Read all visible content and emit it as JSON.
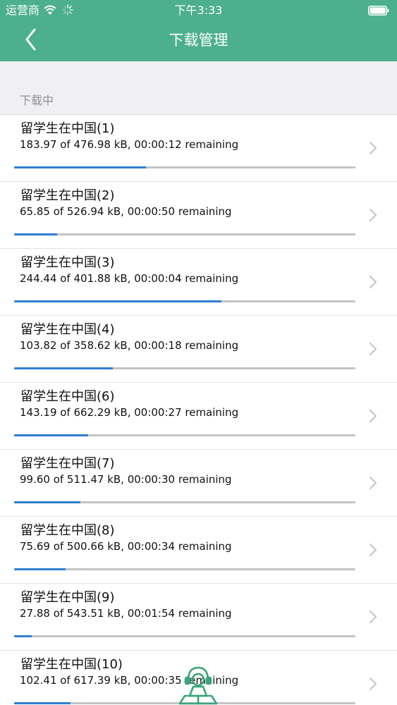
{
  "status_bar": {
    "carrier": "运营商",
    "time": "下午3:33"
  },
  "nav": {
    "title": "下载管理",
    "back_icon": "chevron-left-icon"
  },
  "section": {
    "header": "下载中"
  },
  "downloads": [
    {
      "title": "留学生在中国(1)",
      "detail": "183.97 of 476.98 kB, 00:00:12 remaining",
      "progress": 0.3857
    },
    {
      "title": "留学生在中国(2)",
      "detail": "65.85 of 526.94 kB, 00:00:50 remaining",
      "progress": 0.125
    },
    {
      "title": "留学生在中国(3)",
      "detail": "244.44 of 401.88 kB, 00:00:04 remaining",
      "progress": 0.6082
    },
    {
      "title": "留学生在中国(4)",
      "detail": "103.82 of 358.62 kB, 00:00:18 remaining",
      "progress": 0.2895
    },
    {
      "title": "留学生在中国(6)",
      "detail": "143.19 of 662.29 kB, 00:00:27 remaining",
      "progress": 0.2162
    },
    {
      "title": "留学生在中国(7)",
      "detail": "99.60 of 511.47 kB, 00:00:30 remaining",
      "progress": 0.1947
    },
    {
      "title": "留学生在中国(8)",
      "detail": "75.69 of 500.66 kB, 00:00:34 remaining",
      "progress": 0.1512
    },
    {
      "title": "留学生在中国(9)",
      "detail": "27.88 of 543.51 kB, 00:01:54 remaining",
      "progress": 0.0513
    },
    {
      "title": "留学生在中国(10)",
      "detail": "102.41 of 617.39 kB, 00:00:35 remaining",
      "progress": 0.1659
    }
  ],
  "colors": {
    "nav_bar": "#4caf8e",
    "progress_fill": "#2f7fd1",
    "progress_track": "#c4c4c4",
    "mascot": "#3aa57a"
  },
  "icons": {
    "row_chevron": "chevron-right-icon",
    "mascot": "mascot-icon"
  }
}
